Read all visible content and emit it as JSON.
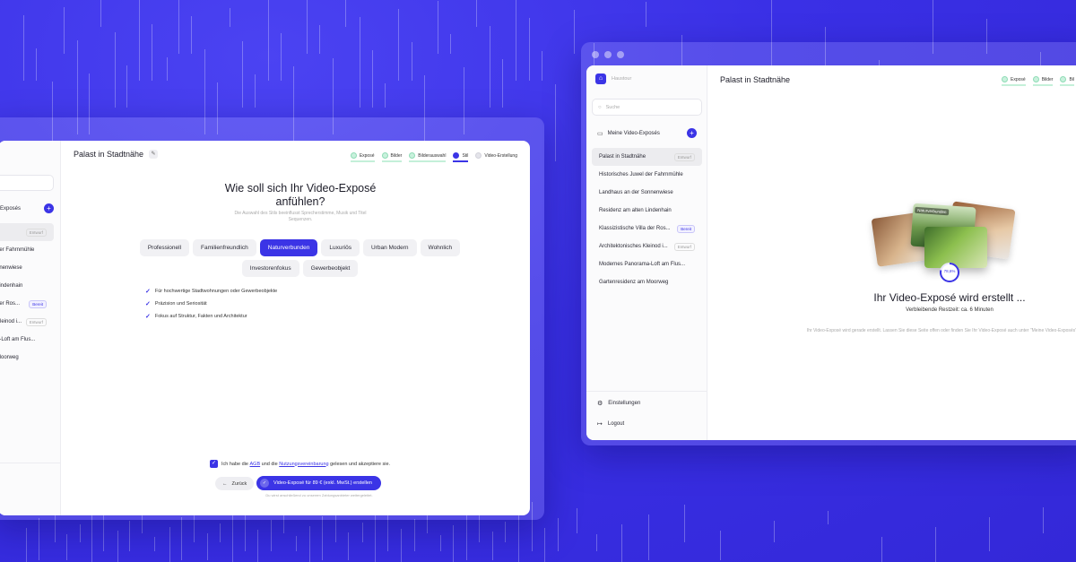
{
  "left_window": {
    "header_title": "Palast in Stadtnähe",
    "steps": [
      "Exposé",
      "Bilder",
      "Bilderauswahl",
      "Stil",
      "Video-Erstellung"
    ],
    "sidebar": {
      "section_label": "Exposés",
      "items": [
        {
          "label": "",
          "badge": "Entwurf"
        },
        {
          "label": "der Fahrnmühle",
          "badge": ""
        },
        {
          "label": "nnenwiese",
          "badge": ""
        },
        {
          "label": "Lindenhain",
          "badge": ""
        },
        {
          "label": "der Ros...",
          "badge": "Bereit"
        },
        {
          "label": "Kleinod i...",
          "badge": "Entwurf"
        },
        {
          "label": "a-Loft am Flus...",
          "badge": ""
        },
        {
          "label": "Moorweg",
          "badge": ""
        }
      ]
    },
    "question_title": "Wie soll sich Ihr Video-Exposé anfühlen?",
    "question_sub": "Die Auswahl des Stils beeinflusst Sprecherstimme, Musik und Titel Sequenzen.",
    "chips_row1": [
      "Professionell",
      "Familienfreundlich",
      "Naturverbunden",
      "Luxuriös",
      "Urban Modern",
      "Wohnlich"
    ],
    "chips_row2": [
      "Investorenfokus",
      "Gewerbeobjekt"
    ],
    "features": [
      "Für hochwertige Stadtwohnungen oder Gewerbeobjekte",
      "Präzision und Seriosität",
      "Fokus auf Struktur, Fakten und Architektur"
    ],
    "consent_pre": "Ich habe die",
    "consent_agb": "AGB",
    "consent_mid": "und die",
    "consent_link": "Nutzungsvereinbarung",
    "consent_post": "gelesen und akzeptiere sie.",
    "back_label": "Zurück",
    "create_label": "Video-Exposé für 89 € (exkl. MwSt.) erstellen",
    "footnote": "Du wirst anschließend zu unserem Zahlungsanbieter weitergeleitet."
  },
  "right_window": {
    "brand": "Haustour",
    "search_placeholder": "Suche",
    "section_label": "Meine Video-Exposés",
    "items": [
      {
        "label": "Palast in Stadtnähe",
        "badge": "Entwurf"
      },
      {
        "label": "Historisches Juwel der Fahrnmühle",
        "badge": ""
      },
      {
        "label": "Landhaus an der Sonnenwiese",
        "badge": ""
      },
      {
        "label": "Residenz am alten Lindenhain",
        "badge": ""
      },
      {
        "label": "Klassizistische Villa der Ros...",
        "badge": "Bereit"
      },
      {
        "label": "Architektonisches Kleinod i...",
        "badge": "Entwurf"
      },
      {
        "label": "Modernes Panorama-Loft am Flus...",
        "badge": ""
      },
      {
        "label": "Gartenresidenz am Moorweg",
        "badge": ""
      }
    ],
    "settings_label": "Einstellungen",
    "logout_label": "Logout",
    "header_title": "Palast in Stadtnähe",
    "steps": [
      "Exposé",
      "Bilder",
      "Bil"
    ],
    "card_label": "Naturverbunden",
    "progress_percent": "78,6%",
    "progress_value": 0.786,
    "status_title": "Ihr Video-Exposé wird erstellt ...",
    "remaining": "Verbleibende Restzeit: ca. 6 Minuten",
    "info": "Ihr Video-Exposé wird gerade erstellt. Lassen Sie diese Seite offen oder finden Sie Ihr Video-Exposé auch unter \"Meine Video-Exposés\" wieder."
  },
  "colors": {
    "background": "#3b2fe0",
    "accent": "#3b34e6",
    "success": "#8fdcb6"
  }
}
